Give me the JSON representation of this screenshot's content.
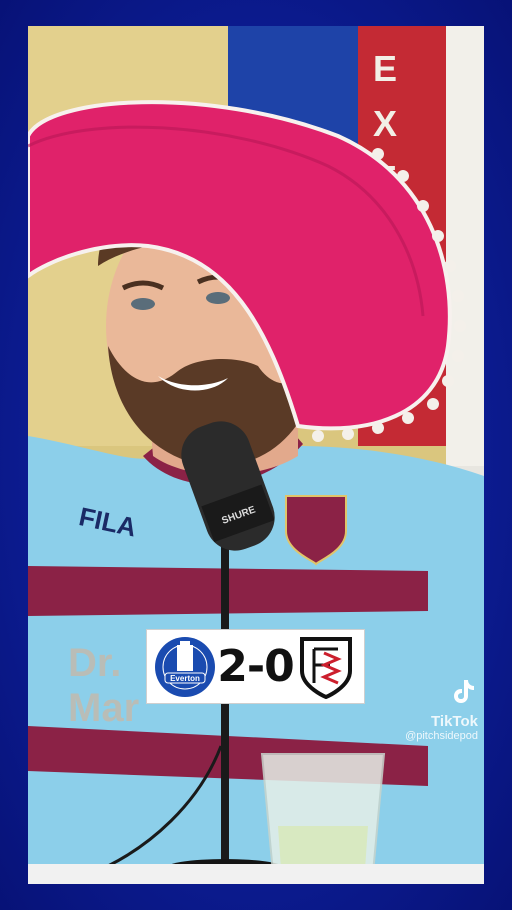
{
  "scoreboard": {
    "home_team": "Everton",
    "score": "2-0",
    "away_team": "Fulham"
  },
  "watermark": {
    "brand": "TikTok",
    "handle": "@pitchsidepod"
  },
  "colors": {
    "background_blue": "#0c1c92",
    "sombrero_pink": "#e0226a",
    "shirt_blue": "#8ed0ec",
    "shirt_claret": "#8b2246"
  }
}
